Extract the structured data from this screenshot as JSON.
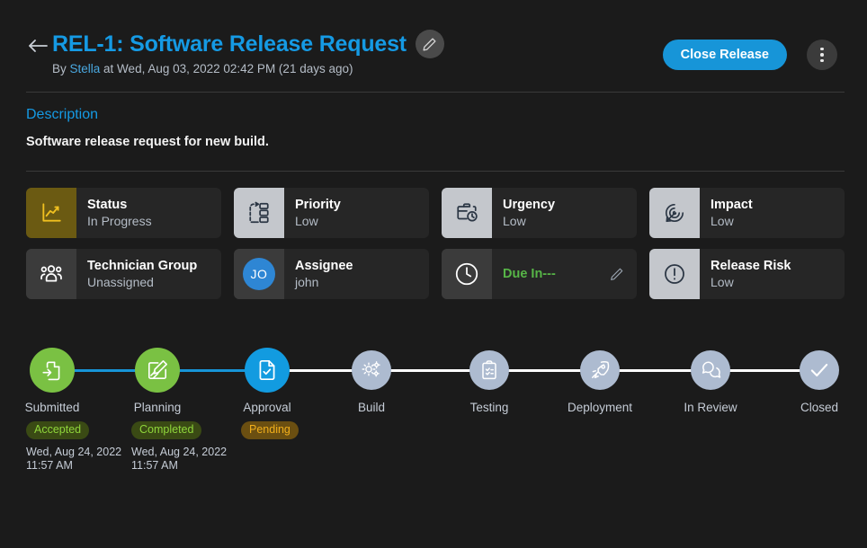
{
  "header": {
    "back_icon": "arrow-left-icon",
    "title": "REL-1: Software Release Request",
    "edit_icon": "pencil-icon",
    "byline_prefix": "By ",
    "author": "Stella",
    "byline_suffix": " at Wed, Aug 03, 2022 02:42 PM (21 days ago)",
    "close_button": "Close Release",
    "more_icon": "kebab-menu-icon",
    "accent_color": "#159ae4",
    "button_color": "#1795d8"
  },
  "description": {
    "label": "Description",
    "text": "Software release request for new build."
  },
  "properties": [
    {
      "label": "Status",
      "value": "In Progress",
      "icon": "line-chart-icon",
      "icon_style": "olive"
    },
    {
      "label": "Priority",
      "value": "Low",
      "icon": "priority-flow-icon",
      "icon_style": "light"
    },
    {
      "label": "Urgency",
      "value": "Low",
      "icon": "briefcase-clock-icon",
      "icon_style": "light"
    },
    {
      "label": "Impact",
      "value": "Low",
      "icon": "target-arrow-icon",
      "icon_style": "light"
    },
    {
      "label": "Technician Group",
      "value": "Unassigned",
      "icon": "user-group-icon",
      "icon_style": "dark"
    },
    {
      "label": "Assignee",
      "value": "john",
      "icon": "avatar",
      "icon_style": "avatar",
      "avatar_initials": "JO",
      "avatar_color": "#2e86d4"
    },
    {
      "label": "Due In---",
      "value": "",
      "icon": "clock-icon",
      "icon_style": "dark",
      "is_due": true,
      "due_color": "#57b547",
      "edit_icon": "pencil-icon"
    },
    {
      "label": "Release Risk",
      "value": "Low",
      "icon": "exclamation-circle-icon",
      "icon_style": "light"
    }
  ],
  "timeline": {
    "steps": [
      {
        "label": "Submitted",
        "icon": "document-import-icon",
        "state": "green",
        "badge": "Accepted",
        "badge_style": "accepted",
        "date": "Wed, Aug 24, 2022",
        "time": "11:57 AM"
      },
      {
        "label": "Planning",
        "icon": "plan-edit-icon",
        "state": "green",
        "badge": "Completed",
        "badge_style": "completed",
        "date": "Wed, Aug 24, 2022",
        "time": "11:57 AM"
      },
      {
        "label": "Approval",
        "icon": "document-check-icon",
        "state": "blue",
        "badge": "Pending",
        "badge_style": "pending",
        "date": "",
        "time": ""
      },
      {
        "label": "Build",
        "icon": "gears-icon",
        "state": "gray",
        "badge": "",
        "badge_style": "",
        "date": "",
        "time": ""
      },
      {
        "label": "Testing",
        "icon": "clipboard-check-icon",
        "state": "gray",
        "badge": "",
        "badge_style": "",
        "date": "",
        "time": ""
      },
      {
        "label": "Deployment",
        "icon": "rocket-icon",
        "state": "gray",
        "badge": "",
        "badge_style": "",
        "date": "",
        "time": ""
      },
      {
        "label": "In Review",
        "icon": "chat-bubbles-icon",
        "state": "gray",
        "badge": "",
        "badge_style": "",
        "date": "",
        "time": ""
      },
      {
        "label": "Closed",
        "icon": "check-icon",
        "state": "gray",
        "badge": "",
        "badge_style": "",
        "date": "",
        "time": ""
      }
    ],
    "done_color": "#1795d8",
    "todo_color": "#ffffff",
    "green_color": "#7ac143",
    "blue_color": "#129be0",
    "gray_color": "#adbbd0"
  }
}
